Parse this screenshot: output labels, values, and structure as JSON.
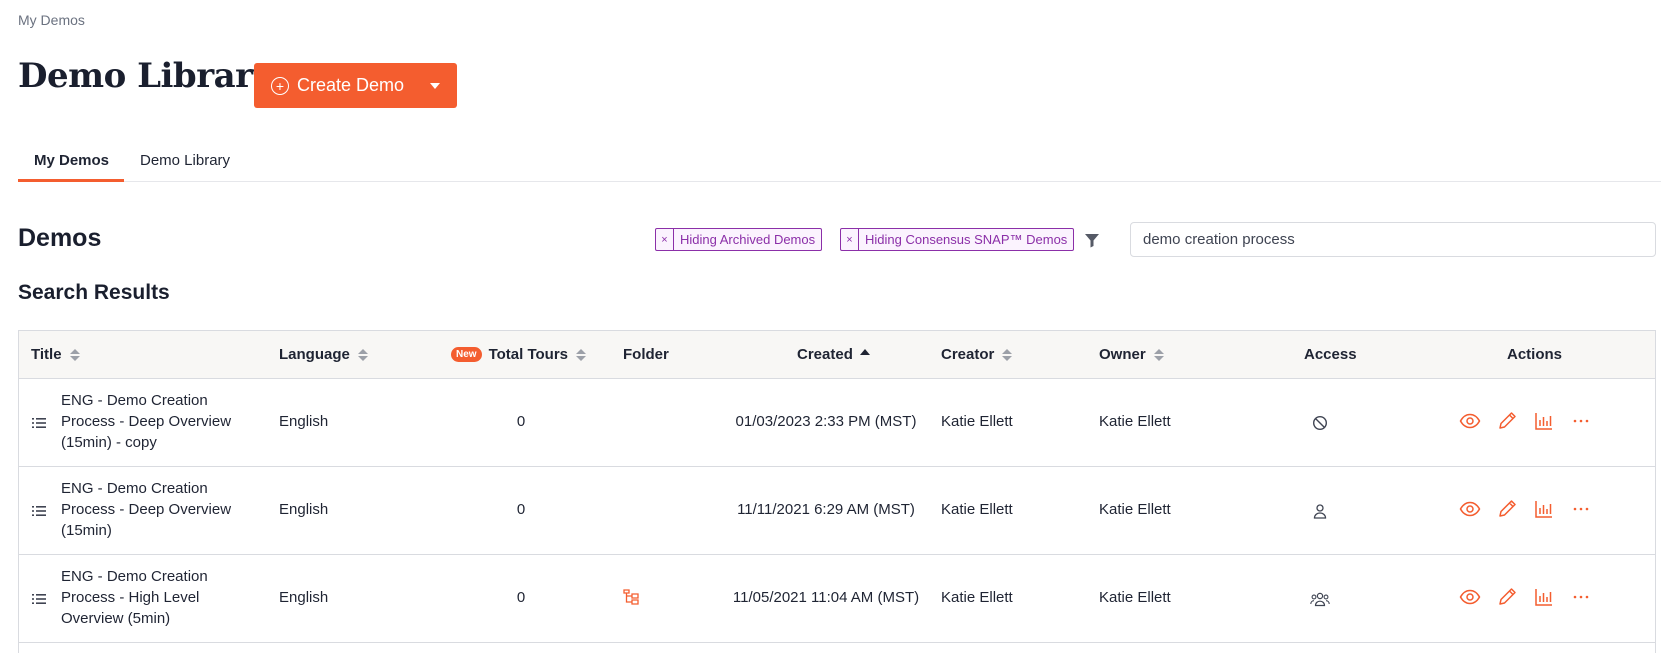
{
  "breadcrumb": "My Demos",
  "page_title": "Demo Library",
  "create_button": {
    "label": "Create Demo",
    "icon": "plus-circle-icon"
  },
  "tabs": [
    {
      "label": "My Demos",
      "active": true
    },
    {
      "label": "Demo Library",
      "active": false
    }
  ],
  "section_title": "Demos",
  "results_title": "Search Results",
  "filter_chips": [
    {
      "remove": "×",
      "label": "Hiding Archived Demos"
    },
    {
      "remove": "×",
      "label": "Hiding Consensus SNAP™ Demos"
    }
  ],
  "search": {
    "value": "demo creation process"
  },
  "table": {
    "headers": {
      "title": "Title",
      "language": "Language",
      "new_badge": "New",
      "total_tours": "Total Tours",
      "folder": "Folder",
      "created": "Created",
      "creator": "Creator",
      "owner": "Owner",
      "access": "Access",
      "actions": "Actions"
    },
    "rows": [
      {
        "title": "ENG - Demo Creation Process - Deep Overview (15min) - copy",
        "language": "English",
        "total_tours": "0",
        "folder_icon": "",
        "created": "01/03/2023 2:33 PM (MST)",
        "creator": "Katie Ellett",
        "owner": "Katie Ellett",
        "access_icon": "no-access-icon"
      },
      {
        "title": "ENG - Demo Creation Process - Deep Overview (15min)",
        "language": "English",
        "total_tours": "0",
        "folder_icon": "",
        "created": "11/11/2021 6:29 AM (MST)",
        "creator": "Katie Ellett",
        "owner": "Katie Ellett",
        "access_icon": "single-user-icon"
      },
      {
        "title": "ENG - Demo Creation Process - High Level Overview (5min)",
        "language": "English",
        "total_tours": "0",
        "folder_icon": "folder-tree-icon",
        "created": "11/05/2021 11:04 AM (MST)",
        "creator": "Katie Ellett",
        "owner": "Katie Ellett",
        "access_icon": "group-users-icon"
      }
    ]
  },
  "colors": {
    "accent": "#f45d2f",
    "chip": "#8b2fa8",
    "text": "#1f2433"
  }
}
